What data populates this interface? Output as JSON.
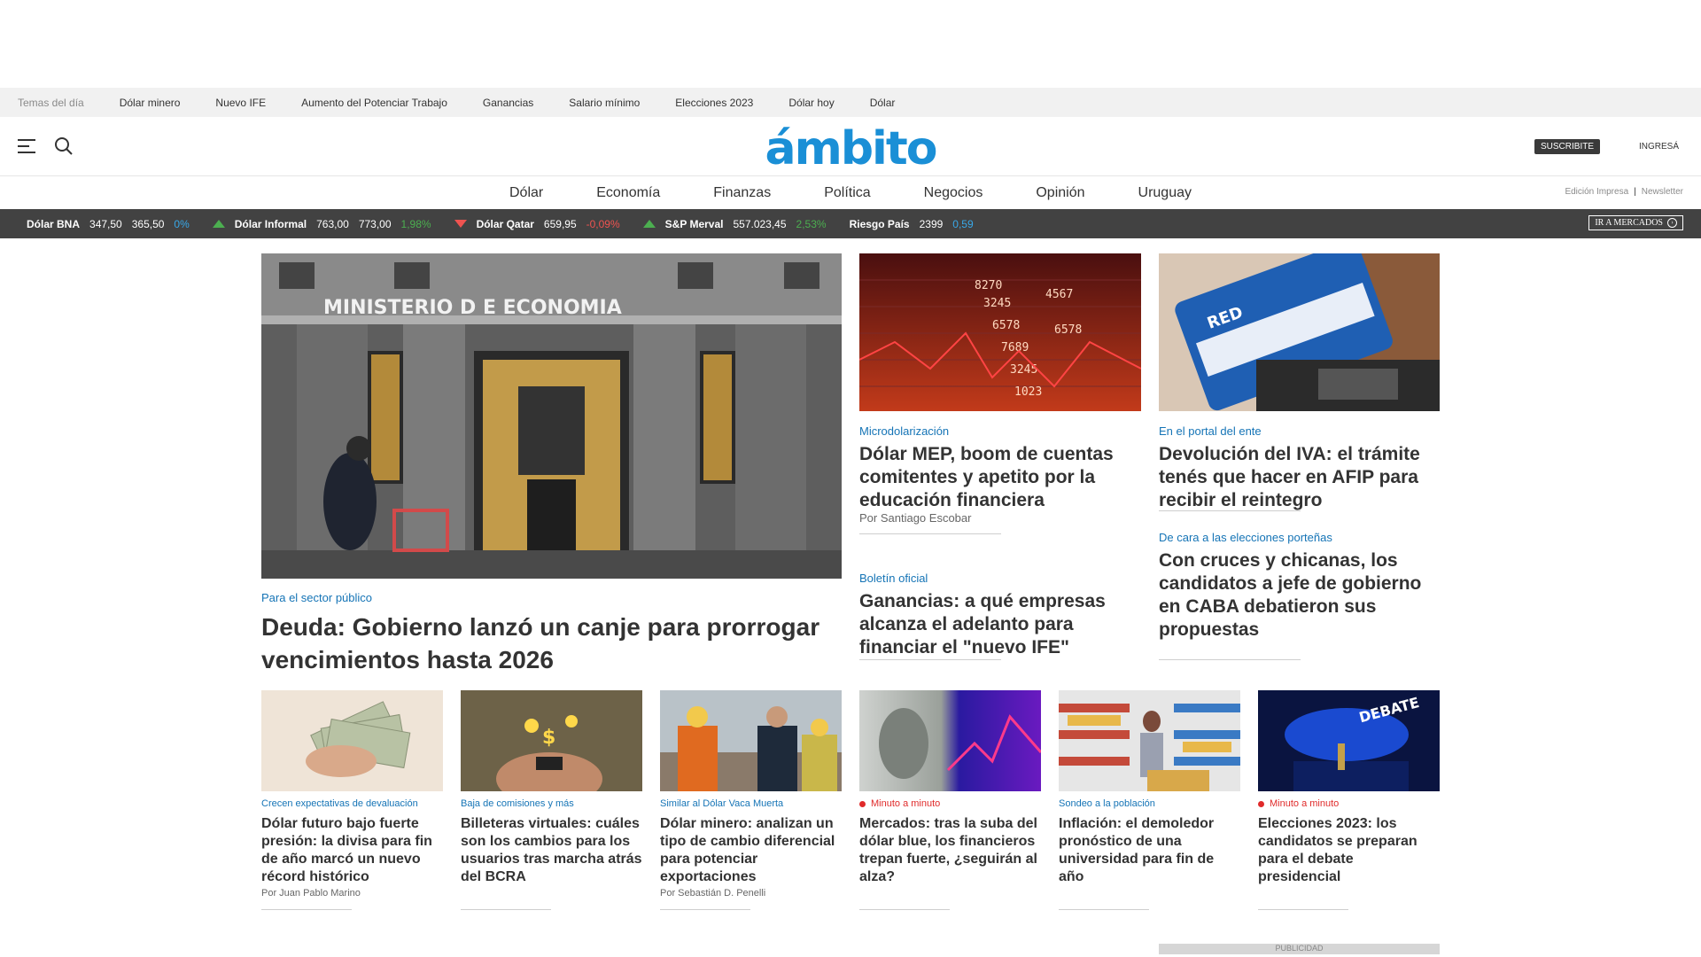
{
  "topics": {
    "lead": "Temas del día",
    "items": [
      "Dólar minero",
      "Nuevo IFE",
      "Aumento del Potenciar Trabajo",
      "Ganancias",
      "Salario mínimo",
      "Elecciones 2023",
      "Dólar hoy",
      "Dólar"
    ]
  },
  "header": {
    "logo": "ámbito",
    "subscribe": "SUSCRIBITE",
    "login": "INGRESÁ",
    "menu_icon": "hamburger-menu-icon",
    "search_icon": "search-icon"
  },
  "nav": {
    "items": [
      "Dólar",
      "Economía",
      "Finanzas",
      "Política",
      "Negocios",
      "Opinión",
      "Uruguay"
    ],
    "edition": "Edición Impresa",
    "separator": "|",
    "newsletter": "Newsletter"
  },
  "ticker": {
    "items": [
      {
        "name": "Dólar BNA",
        "buy": "347,50",
        "sell": "365,50",
        "change": "0%",
        "trend": "flat"
      },
      {
        "name": "Dólar Informal",
        "buy": "763,00",
        "sell": "773,00",
        "change": "1,98%",
        "trend": "up"
      },
      {
        "name": "Dólar Qatar",
        "buy": "659,95",
        "sell": "",
        "change": "-0,09%",
        "trend": "down"
      },
      {
        "name": "S&P Merval",
        "buy": "557.023,45",
        "sell": "",
        "change": "2,53%",
        "trend": "up"
      },
      {
        "name": "Riesgo País",
        "buy": "2399",
        "sell": "",
        "change": "0,59",
        "trend": "flat"
      }
    ],
    "markets_button": "IR A MERCADOS"
  },
  "hero": {
    "building_text": "MINISTERIO  D  E  ECONOMIA",
    "kicker": "Para el sector público",
    "title": "Deuda: Gobierno lanzó un canje para prorrogar vencimientos hasta 2026"
  },
  "side1": {
    "kicker": "Microdolarización",
    "title": "Dólar MEP, boom de cuentas comitentes y apetito por la educación financiera",
    "byline": "Por Santiago Escobar"
  },
  "side2": {
    "kicker": "En el portal del ente",
    "title": "Devolución del IVA: el trámite tenés que hacer en AFIP para recibir el reintegro"
  },
  "side3": {
    "kicker": "Boletín oficial",
    "title": "Ganancias: a qué empresas alcanza el adelanto para financiar el \"nuevo IFE\""
  },
  "side4": {
    "kicker": "De cara a las elecciones porteñas",
    "title": "Con cruces y chicanas, los candidatos a jefe de gobierno en CABA debatieron sus propuestas"
  },
  "cards": [
    {
      "kicker": "Crecen expectativas de devaluación",
      "title": "Dólar futuro bajo fuerte presión: la divisa para fin de año marcó un nuevo récord histórico",
      "byline": "Por Juan Pablo Marino",
      "live": false
    },
    {
      "kicker": "Baja de comisiones y más",
      "title": "Billeteras virtuales: cuáles son los cambios para los usuarios tras marcha atrás del BCRA",
      "byline": "",
      "live": false
    },
    {
      "kicker": "Similar al Dólar Vaca Muerta",
      "title": "Dólar minero: analizan un tipo de cambio diferencial para potenciar exportaciones",
      "byline": "Por Sebastián D. Penelli",
      "live": false
    },
    {
      "kicker": "Minuto a minuto",
      "title": "Mercados: tras la suba del dólar blue, los financieros trepan fuerte, ¿seguirán al alza?",
      "byline": "",
      "live": true
    },
    {
      "kicker": "Sondeo a la población",
      "title": "Inflación: el demoledor pronóstico de una universidad para fin de año",
      "byline": "",
      "live": false
    },
    {
      "kicker": "Minuto a minuto",
      "title": "Elecciones 2023: los candidatos se preparan para el debate presidencial",
      "byline": "",
      "live": true
    }
  ],
  "ad_bottom": "PUBLICIDAD",
  "colors": {
    "brand": "#1a8fd6",
    "kicker": "#1574b6",
    "ticker_bg": "#424242",
    "up": "#4caf50",
    "down": "#ef5350",
    "live": "#e02b2b"
  }
}
